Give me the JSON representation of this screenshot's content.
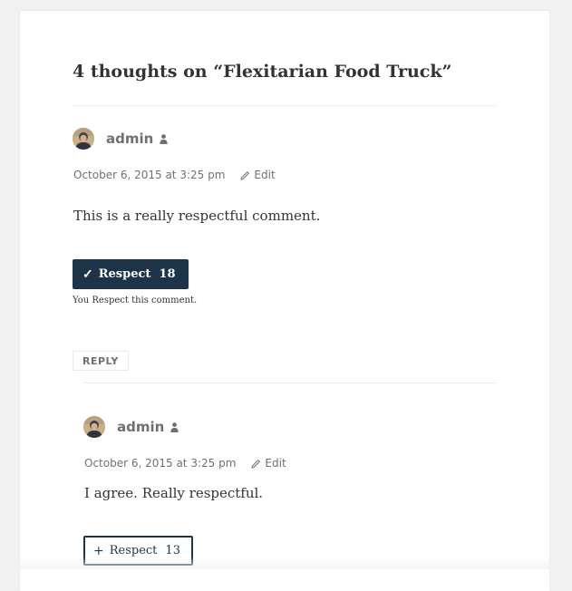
{
  "colors": {
    "page_bg": "#f1f1f1",
    "card_bg": "#ffffff",
    "text": "#333333",
    "muted": "#707070",
    "respect_accent": "#1d3448",
    "rule": "#eaeaea"
  },
  "comments_section": {
    "title": "4 thoughts on “Flexitarian Food Truck”"
  },
  "comments": [
    {
      "author": "admin",
      "author_icon": "user-icon",
      "date": "October 6, 2015 at 3:25 pm",
      "edit_icon": "pencil-icon",
      "edit_label": "Edit",
      "text": "This is a really respectful comment.",
      "respect": {
        "state": "active",
        "symbol": "✓",
        "label": "Respect",
        "count": "18",
        "note": "You Respect this comment."
      },
      "reply_label": "REPLY"
    },
    {
      "author": "admin",
      "author_icon": "user-icon",
      "date": "October 6, 2015 at 3:25 pm",
      "edit_icon": "pencil-icon",
      "edit_label": "Edit",
      "text": "I agree. Really respectful.",
      "respect": {
        "state": "inactive",
        "symbol": "+",
        "label": "Respect",
        "count": "13"
      }
    }
  ]
}
